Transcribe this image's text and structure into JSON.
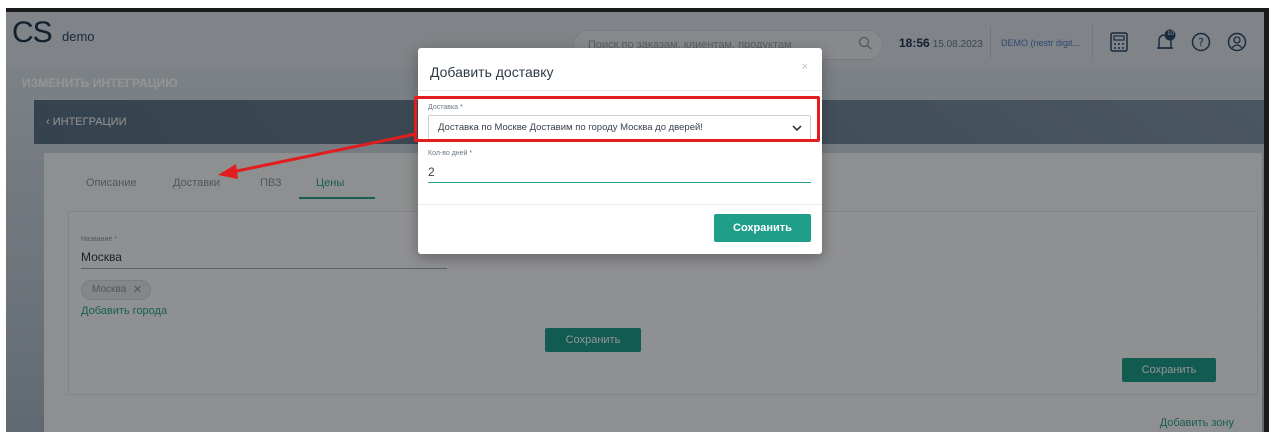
{
  "app": {
    "logo": "CS",
    "logo_sub": "demo"
  },
  "header": {
    "search_placeholder": "Поиск по заказам, клиентам, продуктам",
    "time": "18:56",
    "date": "15.08.2023",
    "user": "DEMO (nestr digit...",
    "notification_count": "10",
    "icons": [
      "calculator-icon",
      "bell-icon",
      "help-icon",
      "user-icon"
    ]
  },
  "page": {
    "title": "ИЗМЕНИТЬ ИНТЕГРАЦИЮ",
    "breadcrumb": "ИНТЕГРАЦИИ"
  },
  "tabs": [
    {
      "label": "Описание"
    },
    {
      "label": "Доставки"
    },
    {
      "label": "ПВЗ"
    },
    {
      "label": "Цены"
    }
  ],
  "zone": {
    "name_label": "Название *",
    "name_value": "Москва",
    "chip": "Москва",
    "add_city": "Добавить города",
    "save_center": "Сохранить",
    "save_right": "Сохранить",
    "add_zone": "Добавить зону"
  },
  "modal": {
    "title": "Добавить доставку",
    "close": "×",
    "delivery_label": "Доставка *",
    "delivery_value": "Доставка по Москве Доставим по городу Москва до дверей!",
    "days_label": "Кол-во дней *",
    "days_value": "2",
    "save": "Сохранить"
  },
  "colors": {
    "accent": "#1f9e8a",
    "highlight": "#e11d1d",
    "header": "#dce2e8"
  }
}
